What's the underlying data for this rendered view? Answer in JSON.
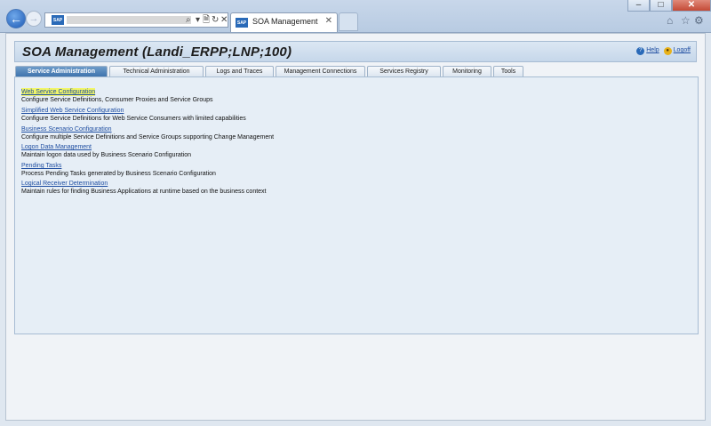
{
  "browser": {
    "tab_title": "SOA Management",
    "address_logo_text": "SAP",
    "address_controls": [
      "⌕",
      "▾",
      "🗎",
      "↻",
      "✕"
    ],
    "window_controls": {
      "minimize": "–",
      "maximize": "□",
      "close": "✕"
    },
    "toolbar_icons": [
      "home-icon",
      "star-icon",
      "gear-icon"
    ]
  },
  "header": {
    "title": "SOA Management (Landi_ERPP;LNP;100)",
    "help": "Help",
    "logoff": "Logoff"
  },
  "tabs": [
    {
      "label": "Service Administration",
      "active": true
    },
    {
      "label": "Technical Administration",
      "active": false
    },
    {
      "label": "Logs and Traces",
      "active": false
    },
    {
      "label": "Management Connections",
      "active": false
    },
    {
      "label": "Services Registry",
      "active": false
    },
    {
      "label": "Monitoring",
      "active": false
    },
    {
      "label": "Tools",
      "active": false
    }
  ],
  "items": [
    {
      "link": "Web Service Configuration",
      "desc": "Configure Service Definitions, Consumer Proxies and Service Groups",
      "highlighted": true
    },
    {
      "link": "Simplified Web Service Configuration",
      "desc": "Configure Service Definitions for Web Service Consumers with limited capabilities"
    },
    {
      "link": "Business Scenario Configuration",
      "desc": "Configure multiple Service Definitions and Service Groups supporting Change Management"
    },
    {
      "link": "Logon Data Management",
      "desc": "Maintain logon data used by Business Scenario Configuration"
    },
    {
      "link": "Pending Tasks",
      "desc": "Process Pending Tasks generated by Business Scenario Configuration"
    },
    {
      "link": "Logical Receiver Determination",
      "desc": "Maintain rules for finding Business Applications at runtime based on the business context"
    }
  ],
  "colors": {
    "active_tab": "#3f74ad",
    "link": "#1f4ea1",
    "highlight": "#f2f66a"
  }
}
